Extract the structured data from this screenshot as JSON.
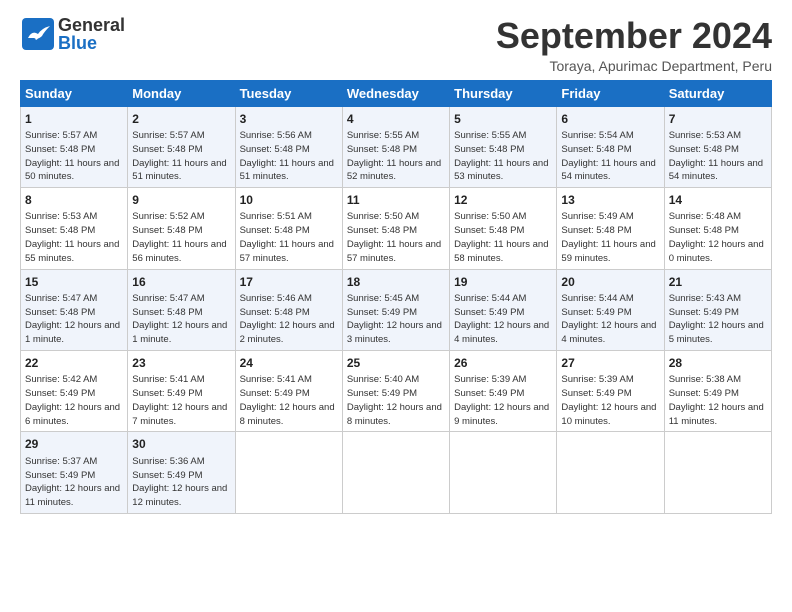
{
  "header": {
    "logo_general": "General",
    "logo_blue": "Blue",
    "month_title": "September 2024",
    "location": "Toraya, Apurimac Department, Peru"
  },
  "weekdays": [
    "Sunday",
    "Monday",
    "Tuesday",
    "Wednesday",
    "Thursday",
    "Friday",
    "Saturday"
  ],
  "weeks": [
    [
      {
        "day": "1",
        "sunrise": "5:57 AM",
        "sunset": "5:48 PM",
        "daylight": "11 hours and 50 minutes."
      },
      {
        "day": "2",
        "sunrise": "5:57 AM",
        "sunset": "5:48 PM",
        "daylight": "11 hours and 51 minutes."
      },
      {
        "day": "3",
        "sunrise": "5:56 AM",
        "sunset": "5:48 PM",
        "daylight": "11 hours and 51 minutes."
      },
      {
        "day": "4",
        "sunrise": "5:55 AM",
        "sunset": "5:48 PM",
        "daylight": "11 hours and 52 minutes."
      },
      {
        "day": "5",
        "sunrise": "5:55 AM",
        "sunset": "5:48 PM",
        "daylight": "11 hours and 53 minutes."
      },
      {
        "day": "6",
        "sunrise": "5:54 AM",
        "sunset": "5:48 PM",
        "daylight": "11 hours and 54 minutes."
      },
      {
        "day": "7",
        "sunrise": "5:53 AM",
        "sunset": "5:48 PM",
        "daylight": "11 hours and 54 minutes."
      }
    ],
    [
      {
        "day": "8",
        "sunrise": "5:53 AM",
        "sunset": "5:48 PM",
        "daylight": "11 hours and 55 minutes."
      },
      {
        "day": "9",
        "sunrise": "5:52 AM",
        "sunset": "5:48 PM",
        "daylight": "11 hours and 56 minutes."
      },
      {
        "day": "10",
        "sunrise": "5:51 AM",
        "sunset": "5:48 PM",
        "daylight": "11 hours and 57 minutes."
      },
      {
        "day": "11",
        "sunrise": "5:50 AM",
        "sunset": "5:48 PM",
        "daylight": "11 hours and 57 minutes."
      },
      {
        "day": "12",
        "sunrise": "5:50 AM",
        "sunset": "5:48 PM",
        "daylight": "11 hours and 58 minutes."
      },
      {
        "day": "13",
        "sunrise": "5:49 AM",
        "sunset": "5:48 PM",
        "daylight": "11 hours and 59 minutes."
      },
      {
        "day": "14",
        "sunrise": "5:48 AM",
        "sunset": "5:48 PM",
        "daylight": "12 hours and 0 minutes."
      }
    ],
    [
      {
        "day": "15",
        "sunrise": "5:47 AM",
        "sunset": "5:48 PM",
        "daylight": "12 hours and 1 minute."
      },
      {
        "day": "16",
        "sunrise": "5:47 AM",
        "sunset": "5:48 PM",
        "daylight": "12 hours and 1 minute."
      },
      {
        "day": "17",
        "sunrise": "5:46 AM",
        "sunset": "5:48 PM",
        "daylight": "12 hours and 2 minutes."
      },
      {
        "day": "18",
        "sunrise": "5:45 AM",
        "sunset": "5:49 PM",
        "daylight": "12 hours and 3 minutes."
      },
      {
        "day": "19",
        "sunrise": "5:44 AM",
        "sunset": "5:49 PM",
        "daylight": "12 hours and 4 minutes."
      },
      {
        "day": "20",
        "sunrise": "5:44 AM",
        "sunset": "5:49 PM",
        "daylight": "12 hours and 4 minutes."
      },
      {
        "day": "21",
        "sunrise": "5:43 AM",
        "sunset": "5:49 PM",
        "daylight": "12 hours and 5 minutes."
      }
    ],
    [
      {
        "day": "22",
        "sunrise": "5:42 AM",
        "sunset": "5:49 PM",
        "daylight": "12 hours and 6 minutes."
      },
      {
        "day": "23",
        "sunrise": "5:41 AM",
        "sunset": "5:49 PM",
        "daylight": "12 hours and 7 minutes."
      },
      {
        "day": "24",
        "sunrise": "5:41 AM",
        "sunset": "5:49 PM",
        "daylight": "12 hours and 8 minutes."
      },
      {
        "day": "25",
        "sunrise": "5:40 AM",
        "sunset": "5:49 PM",
        "daylight": "12 hours and 8 minutes."
      },
      {
        "day": "26",
        "sunrise": "5:39 AM",
        "sunset": "5:49 PM",
        "daylight": "12 hours and 9 minutes."
      },
      {
        "day": "27",
        "sunrise": "5:39 AM",
        "sunset": "5:49 PM",
        "daylight": "12 hours and 10 minutes."
      },
      {
        "day": "28",
        "sunrise": "5:38 AM",
        "sunset": "5:49 PM",
        "daylight": "12 hours and 11 minutes."
      }
    ],
    [
      {
        "day": "29",
        "sunrise": "5:37 AM",
        "sunset": "5:49 PM",
        "daylight": "12 hours and 11 minutes."
      },
      {
        "day": "30",
        "sunrise": "5:36 AM",
        "sunset": "5:49 PM",
        "daylight": "12 hours and 12 minutes."
      },
      null,
      null,
      null,
      null,
      null
    ]
  ]
}
